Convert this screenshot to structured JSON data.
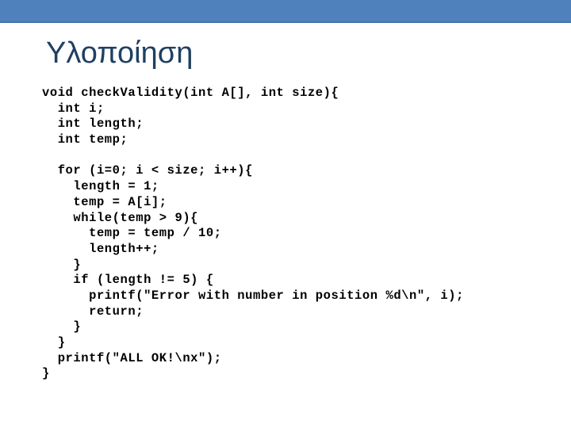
{
  "slide": {
    "title": "Υλοποίηση",
    "banner_color": "#4f81bd",
    "title_color": "#1f4061",
    "background_color": "#ffffff",
    "code_color": "#000000"
  },
  "code": {
    "language": "c",
    "lines": [
      "void checkValidity(int A[], int size){",
      "  int i;",
      "  int length;",
      "  int temp;",
      "",
      "  for (i=0; i < size; i++){",
      "    length = 1;",
      "    temp = A[i];",
      "    while(temp > 9){",
      "      temp = temp / 10;",
      "      length++;",
      "    }",
      "    if (length != 5) {",
      "      printf(\"Error with number in position %d\\n\", i);",
      "      return;",
      "    }",
      "  }",
      "  printf(\"ALL OK!\\nx\");",
      "}"
    ]
  }
}
